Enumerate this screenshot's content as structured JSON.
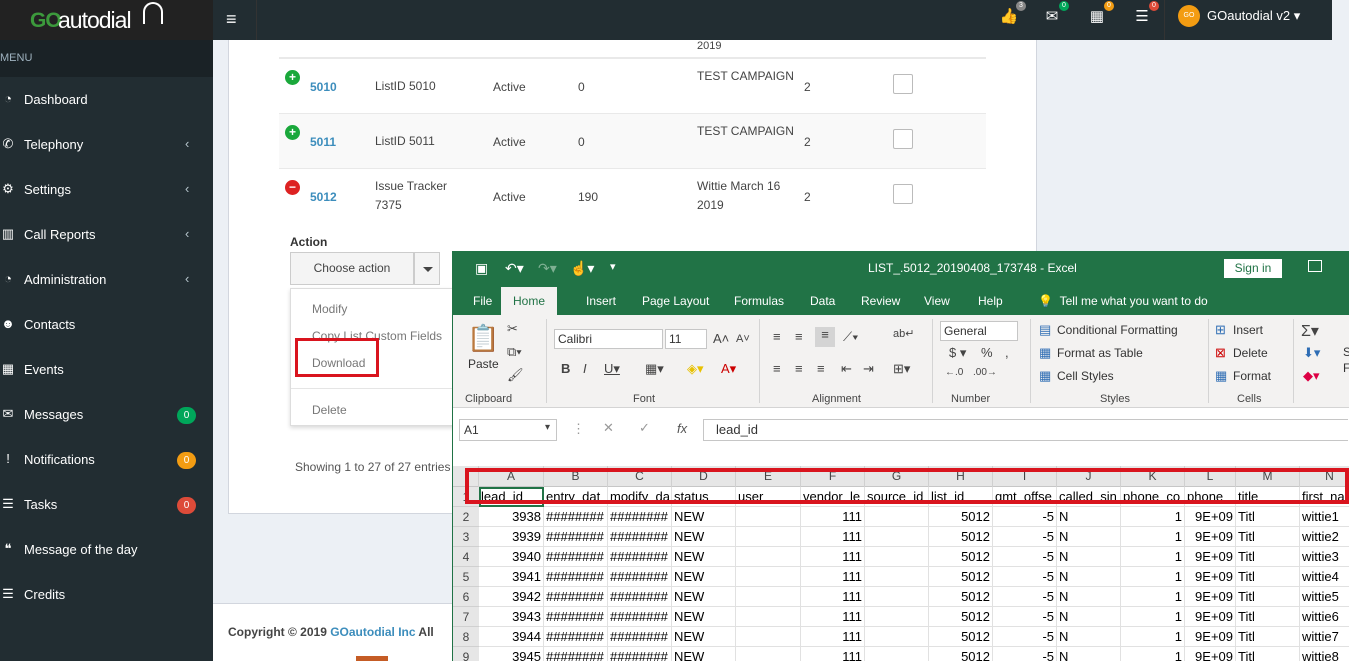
{
  "header": {
    "logo_go": "GO",
    "logo_brand": "autodial",
    "username": "GOautodial v2",
    "avatar_initials": "GO",
    "icons": [
      {
        "name": "thumbs-up-icon",
        "glyph": "👍",
        "badge": "3",
        "color": "#888888"
      },
      {
        "name": "envelope-icon",
        "glyph": "✉",
        "badge": "0",
        "color": "#00a65a"
      },
      {
        "name": "calendar-icon",
        "glyph": "▦",
        "badge": "0",
        "color": "#f39c12"
      },
      {
        "name": "tasks-icon",
        "glyph": "☰",
        "badge": "0",
        "color": "#dd4b39"
      }
    ]
  },
  "sidebar": {
    "menu_label": "MENU",
    "items": [
      {
        "label": "Dashboard",
        "icon": "dashboard-icon",
        "glyph": "◔",
        "chevron": false,
        "badge": null,
        "badge_color": null
      },
      {
        "label": "Telephony",
        "icon": "phone-icon",
        "glyph": "✆",
        "chevron": true,
        "badge": null,
        "badge_color": null
      },
      {
        "label": "Settings",
        "icon": "gear-icon",
        "glyph": "⚙",
        "chevron": true,
        "badge": null,
        "badge_color": null
      },
      {
        "label": "Call Reports",
        "icon": "bar-chart-icon",
        "glyph": "▥",
        "chevron": true,
        "badge": null,
        "badge_color": null
      },
      {
        "label": "Administration",
        "icon": "dashboard-icon",
        "glyph": "◔",
        "chevron": true,
        "badge": null,
        "badge_color": null
      },
      {
        "label": "Contacts",
        "icon": "users-icon",
        "glyph": "☻",
        "chevron": false,
        "badge": null,
        "badge_color": null
      },
      {
        "label": "Events",
        "icon": "calendar-icon",
        "glyph": "▦",
        "chevron": false,
        "badge": null,
        "badge_color": null
      },
      {
        "label": "Messages",
        "icon": "envelope-icon",
        "glyph": "✉",
        "chevron": false,
        "badge": "0",
        "badge_color": "#00a65a"
      },
      {
        "label": "Notifications",
        "icon": "exclamation-icon",
        "glyph": "!",
        "chevron": false,
        "badge": "0",
        "badge_color": "#f39c12"
      },
      {
        "label": "Tasks",
        "icon": "tasks-icon",
        "glyph": "☰",
        "chevron": false,
        "badge": "0",
        "badge_color": "#dd4b39"
      },
      {
        "label": "Message of the day",
        "icon": "quote-icon",
        "glyph": "❝",
        "chevron": false,
        "badge": null,
        "badge_color": null
      },
      {
        "label": "Credits",
        "icon": "list-icon",
        "glyph": "☰",
        "chevron": false,
        "badge": null,
        "badge_color": null
      }
    ]
  },
  "lists_table": {
    "top_partial": "2019",
    "rows": [
      {
        "id": "5010",
        "name": "ListID 5010",
        "status": "Active",
        "leads": "0",
        "campaign": "TEST CAMPAIGN",
        "count": "2",
        "toggle": "+"
      },
      {
        "id": "5011",
        "name": "ListID 5011",
        "status": "Active",
        "leads": "0",
        "campaign": "TEST CAMPAIGN",
        "count": "2",
        "toggle": "+"
      },
      {
        "id": "5012",
        "name": "Issue Tracker 7375",
        "status": "Active",
        "leads": "190",
        "campaign": "Wittie March 16 2019",
        "count": "2",
        "toggle": "−"
      }
    ],
    "action_label": "Action",
    "action_button": "Choose action",
    "dropdown": [
      "Modify",
      "Copy List Custom Fields",
      "Download",
      "Delete"
    ],
    "showing": "Showing 1 to 27 of 27 entries"
  },
  "footer": {
    "copyright": "Copyright © 2019 ",
    "company": "GOautodial Inc",
    "suffix": " All"
  },
  "excel": {
    "window_title": "LIST_.5012_20190408_173748  -  Excel",
    "sign_in": "Sign in",
    "tabs": [
      "File",
      "Home",
      "Insert",
      "Page Layout",
      "Formulas",
      "Data",
      "Review",
      "View",
      "Help"
    ],
    "tell_me": "Tell me what you want to do",
    "ribbon": {
      "paste": "Paste",
      "clipboard": "Clipboard",
      "font_name": "Calibri",
      "font_size": "11",
      "font_group": "Font",
      "alignment_group": "Alignment",
      "number_format": "General",
      "number_group": "Number",
      "conditional": "Conditional Formatting",
      "format_table": "Format as Table",
      "cell_styles": "Cell Styles",
      "styles_group": "Styles",
      "insert": "Insert",
      "delete": "Delete",
      "format": "Format",
      "cells_group": "Cells",
      "editing_s": "S",
      "editing_f": "F"
    },
    "name_box": "A1",
    "formula_value": "lead_id",
    "columns": [
      "A",
      "B",
      "C",
      "D",
      "E",
      "F",
      "G",
      "H",
      "I",
      "J",
      "K",
      "L",
      "M",
      "N"
    ],
    "headers": [
      "lead_id",
      "entry_dat",
      "modify_da",
      "status",
      "user",
      "vendor_le",
      "source_id",
      "list_id",
      "gmt_offse",
      "called_sin",
      "phone_co",
      "phone_",
      "title",
      "first_na"
    ],
    "rows": [
      {
        "row": "2",
        "cells": [
          "3938",
          "########",
          "########",
          "NEW",
          "",
          "111",
          "",
          "5012",
          "-5",
          "N",
          "1",
          "9E+09",
          "Titl",
          "wittie1"
        ]
      },
      {
        "row": "3",
        "cells": [
          "3939",
          "########",
          "########",
          "NEW",
          "",
          "111",
          "",
          "5012",
          "-5",
          "N",
          "1",
          "9E+09",
          "Titl",
          "wittie2"
        ]
      },
      {
        "row": "4",
        "cells": [
          "3940",
          "########",
          "########",
          "NEW",
          "",
          "111",
          "",
          "5012",
          "-5",
          "N",
          "1",
          "9E+09",
          "Titl",
          "wittie3"
        ]
      },
      {
        "row": "5",
        "cells": [
          "3941",
          "########",
          "########",
          "NEW",
          "",
          "111",
          "",
          "5012",
          "-5",
          "N",
          "1",
          "9E+09",
          "Titl",
          "wittie4"
        ]
      },
      {
        "row": "6",
        "cells": [
          "3942",
          "########",
          "########",
          "NEW",
          "",
          "111",
          "",
          "5012",
          "-5",
          "N",
          "1",
          "9E+09",
          "Titl",
          "wittie5"
        ]
      },
      {
        "row": "7",
        "cells": [
          "3943",
          "########",
          "########",
          "NEW",
          "",
          "111",
          "",
          "5012",
          "-5",
          "N",
          "1",
          "9E+09",
          "Titl",
          "wittie6"
        ]
      },
      {
        "row": "8",
        "cells": [
          "3944",
          "########",
          "########",
          "NEW",
          "",
          "111",
          "",
          "5012",
          "-5",
          "N",
          "1",
          "9E+09",
          "Titl",
          "wittie7"
        ]
      },
      {
        "row": "9",
        "cells": [
          "3945",
          "########",
          "########",
          "NEW",
          "",
          "111",
          "",
          "5012",
          "-5",
          "N",
          "1",
          "9E+09",
          "Titl",
          "wittie8"
        ]
      }
    ]
  },
  "colors": {
    "excel_green": "#217346",
    "sidebar_bg": "#222d32",
    "highlight_red": "#d9141e",
    "link_blue": "#3c8dbc"
  }
}
